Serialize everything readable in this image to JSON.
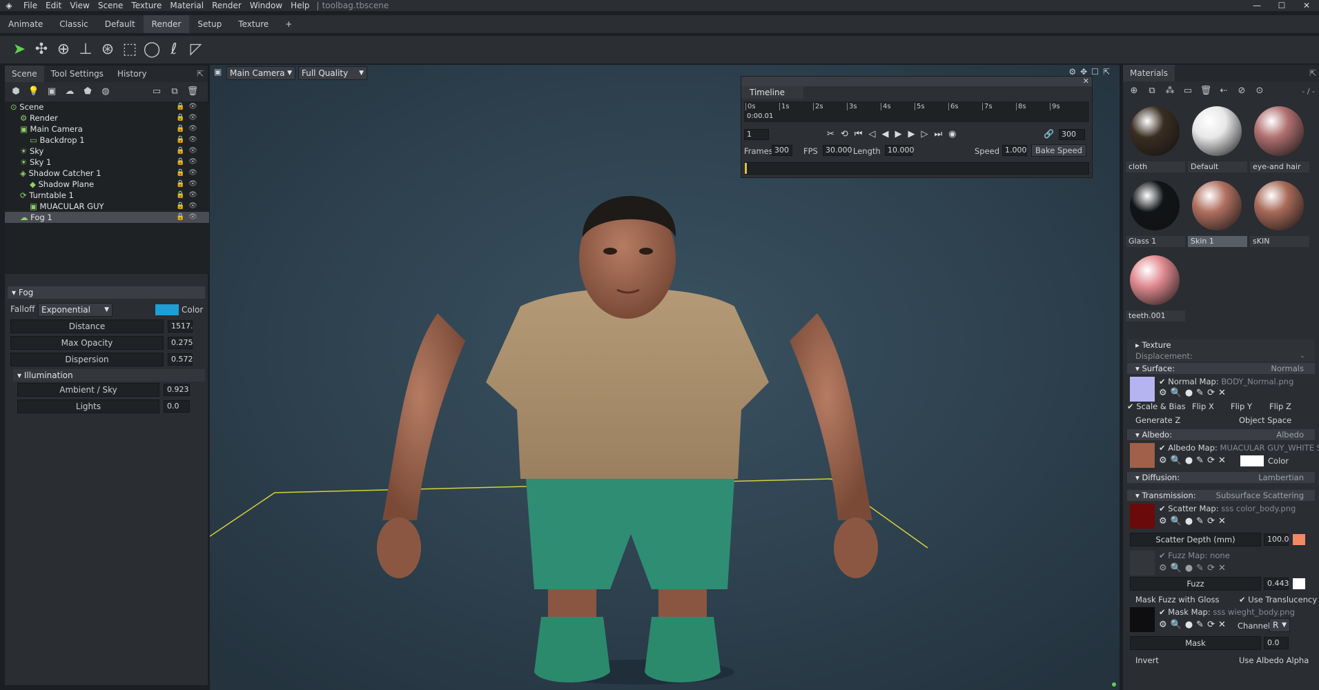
{
  "window": {
    "file": "toolbag.tbscene"
  },
  "menu": [
    "File",
    "Edit",
    "View",
    "Scene",
    "Texture",
    "Material",
    "Render",
    "Window",
    "Help"
  ],
  "workspace_tabs": [
    "Animate",
    "Classic",
    "Default",
    "Render",
    "Setup",
    "Texture",
    "+"
  ],
  "active_workspace": "Render",
  "left_tabs": [
    "Scene",
    "Tool Settings",
    "History"
  ],
  "scene_tree": [
    {
      "label": "Scene",
      "depth": 0,
      "icon": "scene"
    },
    {
      "label": "Render",
      "depth": 1,
      "icon": "render"
    },
    {
      "label": "Main Camera",
      "depth": 1,
      "icon": "camera"
    },
    {
      "label": "Backdrop 1",
      "depth": 2,
      "icon": "backdrop"
    },
    {
      "label": "Sky",
      "depth": 1,
      "icon": "sky"
    },
    {
      "label": "Sky 1",
      "depth": 1,
      "icon": "sky"
    },
    {
      "label": "Shadow Catcher 1",
      "depth": 1,
      "icon": "shadow"
    },
    {
      "label": "Shadow Plane",
      "depth": 2,
      "icon": "mesh"
    },
    {
      "label": "Turntable 1",
      "depth": 1,
      "icon": "turntable"
    },
    {
      "label": "MUACULAR GUY",
      "depth": 2,
      "icon": "object"
    },
    {
      "label": "Fog 1",
      "depth": 1,
      "icon": "fog",
      "selected": true
    }
  ],
  "fog": {
    "header": "Fog",
    "falloff_label": "Falloff",
    "falloff": "Exponential",
    "color_label": "Color",
    "color": "#1f9ed6",
    "distance_label": "Distance",
    "distance": "1517.",
    "max_opacity_label": "Max Opacity",
    "max_opacity": "0.275",
    "dispersion_label": "Dispersion",
    "dispersion": "0.572",
    "illum_header": "Illumination",
    "ambient_label": "Ambient / Sky",
    "ambient": "0.923",
    "lights_label": "Lights",
    "lights": "0.0"
  },
  "viewport": {
    "camera": "Main Camera",
    "quality": "Full Quality"
  },
  "timeline": {
    "title": "Timeline",
    "time": "0:00.01",
    "frame": "1",
    "end_frame": "300",
    "ticks": [
      "0s",
      "1s",
      "2s",
      "3s",
      "4s",
      "5s",
      "6s",
      "7s",
      "8s",
      "9s"
    ],
    "frames_label": "Frames",
    "frames": "300",
    "fps_label": "FPS",
    "fps": "30.000",
    "length_label": "Length",
    "length": "10.000",
    "speed_label": "Speed",
    "speed": "1.000",
    "bake": "Bake Speed"
  },
  "materials": {
    "title": "Materials",
    "counter": "- / -",
    "items": [
      {
        "name": "cloth",
        "color": "#3a2d22"
      },
      {
        "name": "Default",
        "color": "#e8e8e8"
      },
      {
        "name": "eye-and hair",
        "color": "#b07070"
      },
      {
        "name": "Glass 1",
        "color": "#111417"
      },
      {
        "name": "Skin 1",
        "color": "#b07060",
        "selected": true
      },
      {
        "name": "sKIN",
        "color": "#a86a58"
      },
      {
        "name": "teeth.001",
        "color": "#e08a90"
      }
    ],
    "texture": "Texture",
    "displacement": "Displacement:",
    "displacement_val": "-",
    "surface": "Surface:",
    "surface_val": "Normals",
    "normal_map": "Normal Map:",
    "normal_file": "BODY_Normal.png",
    "scale_bias": "Scale & Bias",
    "flip_x": "Flip X",
    "flip_y": "Flip Y",
    "flip_z": "Flip Z",
    "gen_z": "Generate Z",
    "obj_space": "Object Space",
    "albedo": "Albedo:",
    "albedo_val": "Albedo",
    "albedo_map": "Albedo Map:",
    "albedo_file": "MUACULAR GUY_WHITE S",
    "color": "Color",
    "diffusion": "Diffusion:",
    "diffusion_val": "Lambertian",
    "transmission": "Transmission:",
    "transmission_val": "Subsurface Scattering",
    "scatter_map": "Scatter Map:",
    "scatter_file": "sss color_body.png",
    "scatter_depth": "Scatter Depth (mm)",
    "scatter_depth_val": "100.0",
    "fuzz_map": "Fuzz Map:",
    "fuzz_file": "none",
    "fuzz": "Fuzz",
    "fuzz_val": "0.443",
    "mask_fuzz": "Mask Fuzz with Gloss",
    "use_trans": "Use Translucency",
    "mask_map": "Mask Map:",
    "mask_file": "sss wieght_body.png",
    "channel": "Channel",
    "channel_val": "R",
    "mask": "Mask",
    "mask_val": "0.0",
    "invert": "Invert",
    "use_alpha": "Use Albedo Alpha"
  }
}
